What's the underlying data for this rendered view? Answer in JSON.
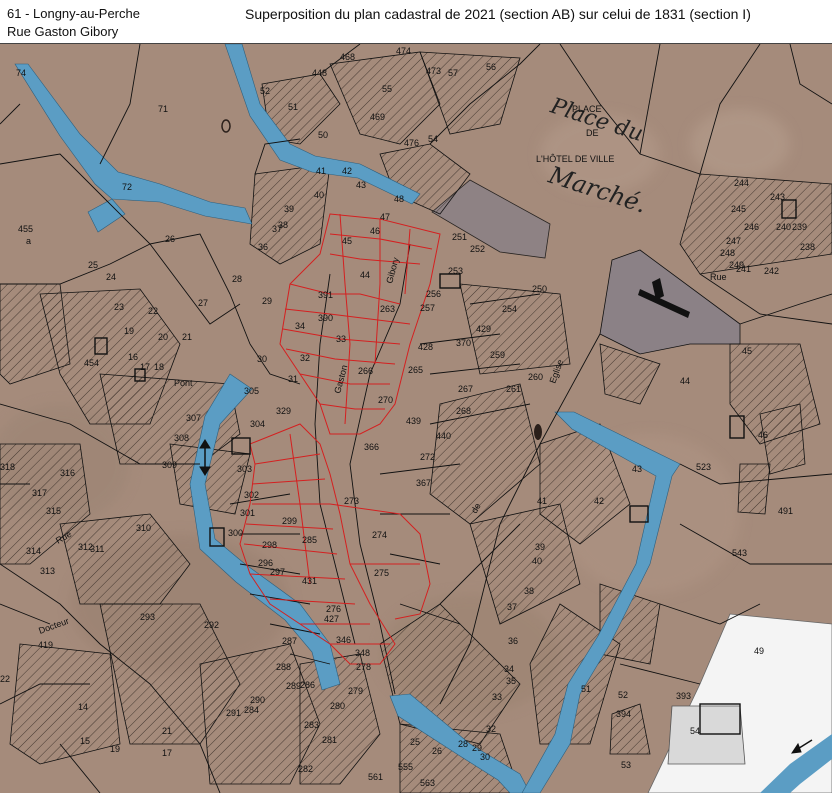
{
  "header": {
    "location_line1": "61 - Longny-au-Perche",
    "location_line2": "Rue Gaston Gibory",
    "title": "Superposition du plan cadastral de 2021 (section AB) sur celui de 1831 (section I)"
  },
  "map": {
    "colors": {
      "paper": "#a58b7b",
      "paper_dark": "#8f7868",
      "water": "#5b9dc4",
      "parcel_line": "#111111",
      "highlight_line": "#d42020",
      "hatch": "#3a2e28",
      "white_area": "#f4f4f4",
      "gray_block": "#8b8186"
    },
    "place_labels": {
      "place": "PLACE",
      "de": "DE",
      "hotel": "L'HÔTEL DE VILLE"
    },
    "handwritten": {
      "place_du": "Place du",
      "marche": "Marché."
    },
    "street_labels": {
      "rue": "Rue",
      "eglise": "Eglise",
      "de": "de",
      "gaston": "Gaston",
      "gibory": "Gibory",
      "docteur": "Docteur",
      "pont": "Pont",
      "rue_242": "Rue"
    },
    "parcels": [
      {
        "n": "74"
      },
      {
        "n": "71"
      },
      {
        "n": "72"
      },
      {
        "n": "26"
      },
      {
        "n": "455"
      },
      {
        "n": "a"
      },
      {
        "n": "25"
      },
      {
        "n": "24"
      },
      {
        "n": "23"
      },
      {
        "n": "22"
      },
      {
        "n": "27"
      },
      {
        "n": "28"
      },
      {
        "n": "29"
      },
      {
        "n": "19"
      },
      {
        "n": "20"
      },
      {
        "n": "21"
      },
      {
        "n": "16"
      },
      {
        "n": "17"
      },
      {
        "n": "18"
      },
      {
        "n": "454"
      },
      {
        "n": "52"
      },
      {
        "n": "51"
      },
      {
        "n": "50"
      },
      {
        "n": "448"
      },
      {
        "n": "468"
      },
      {
        "n": "474"
      },
      {
        "n": "55"
      },
      {
        "n": "469"
      },
      {
        "n": "476"
      },
      {
        "n": "54"
      },
      {
        "n": "473"
      },
      {
        "n": "57"
      },
      {
        "n": "56"
      },
      {
        "n": "41"
      },
      {
        "n": "42"
      },
      {
        "n": "40"
      },
      {
        "n": "43"
      },
      {
        "n": "39"
      },
      {
        "n": "38"
      },
      {
        "n": "37"
      },
      {
        "n": "36"
      },
      {
        "n": "48"
      },
      {
        "n": "47"
      },
      {
        "n": "46"
      },
      {
        "n": "45"
      },
      {
        "n": "44"
      },
      {
        "n": "251"
      },
      {
        "n": "252"
      },
      {
        "n": "253"
      },
      {
        "n": "250"
      },
      {
        "n": "256"
      },
      {
        "n": "257"
      },
      {
        "n": "254"
      },
      {
        "n": "429"
      },
      {
        "n": "370"
      },
      {
        "n": "259"
      },
      {
        "n": "260"
      },
      {
        "n": "261"
      },
      {
        "n": "267"
      },
      {
        "n": "268"
      },
      {
        "n": "263"
      },
      {
        "n": "391"
      },
      {
        "n": "390"
      },
      {
        "n": "34"
      },
      {
        "n": "33"
      },
      {
        "n": "32"
      },
      {
        "n": "31"
      },
      {
        "n": "30"
      },
      {
        "n": "305"
      },
      {
        "n": "329"
      },
      {
        "n": "304"
      },
      {
        "n": "307"
      },
      {
        "n": "308"
      },
      {
        "n": "309"
      },
      {
        "n": "303"
      },
      {
        "n": "302"
      },
      {
        "n": "301"
      },
      {
        "n": "300"
      },
      {
        "n": "299"
      },
      {
        "n": "298"
      },
      {
        "n": "285"
      },
      {
        "n": "431"
      },
      {
        "n": "297"
      },
      {
        "n": "296"
      },
      {
        "n": "276"
      },
      {
        "n": "427"
      },
      {
        "n": "275"
      },
      {
        "n": "274"
      },
      {
        "n": "273"
      },
      {
        "n": "366"
      },
      {
        "n": "270"
      },
      {
        "n": "266"
      },
      {
        "n": "265"
      },
      {
        "n": "439"
      },
      {
        "n": "440"
      },
      {
        "n": "272"
      },
      {
        "n": "367"
      },
      {
        "n": "428"
      },
      {
        "n": "346"
      },
      {
        "n": "348"
      },
      {
        "n": "278"
      },
      {
        "n": "279"
      },
      {
        "n": "280"
      },
      {
        "n": "281"
      },
      {
        "n": "282"
      },
      {
        "n": "283"
      },
      {
        "n": "284"
      },
      {
        "n": "286"
      },
      {
        "n": "287"
      },
      {
        "n": "288"
      },
      {
        "n": "289"
      },
      {
        "n": "290"
      },
      {
        "n": "291"
      },
      {
        "n": "292"
      },
      {
        "n": "293"
      },
      {
        "n": "310"
      },
      {
        "n": "311"
      },
      {
        "n": "312"
      },
      {
        "n": "313"
      },
      {
        "n": "314"
      },
      {
        "n": "315"
      },
      {
        "n": "316"
      },
      {
        "n": "317"
      },
      {
        "n": "318"
      },
      {
        "n": "419"
      },
      {
        "n": "22"
      },
      {
        "n": "14"
      },
      {
        "n": "15"
      },
      {
        "n": "19"
      },
      {
        "n": "17"
      },
      {
        "n": "21"
      },
      {
        "n": "561"
      },
      {
        "n": "555"
      },
      {
        "n": "563"
      },
      {
        "n": "25"
      },
      {
        "n": "26"
      },
      {
        "n": "28"
      },
      {
        "n": "29"
      },
      {
        "n": "30"
      },
      {
        "n": "32"
      },
      {
        "n": "33"
      },
      {
        "n": "34"
      },
      {
        "n": "35"
      },
      {
        "n": "36"
      },
      {
        "n": "37"
      },
      {
        "n": "38"
      },
      {
        "n": "39"
      },
      {
        "n": "40"
      },
      {
        "n": "41"
      },
      {
        "n": "42"
      },
      {
        "n": "43"
      },
      {
        "n": "44"
      },
      {
        "n": "45"
      },
      {
        "n": "46"
      },
      {
        "n": "491"
      },
      {
        "n": "523"
      },
      {
        "n": "543"
      },
      {
        "n": "49"
      },
      {
        "n": "51"
      },
      {
        "n": "52"
      },
      {
        "n": "394"
      },
      {
        "n": "393"
      },
      {
        "n": "53"
      },
      {
        "n": "54"
      },
      {
        "n": "244"
      },
      {
        "n": "245"
      },
      {
        "n": "246"
      },
      {
        "n": "247"
      },
      {
        "n": "248"
      },
      {
        "n": "249"
      },
      {
        "n": "240"
      },
      {
        "n": "239"
      },
      {
        "n": "238"
      },
      {
        "n": "241"
      },
      {
        "n": "242"
      },
      {
        "n": "243"
      }
    ]
  }
}
